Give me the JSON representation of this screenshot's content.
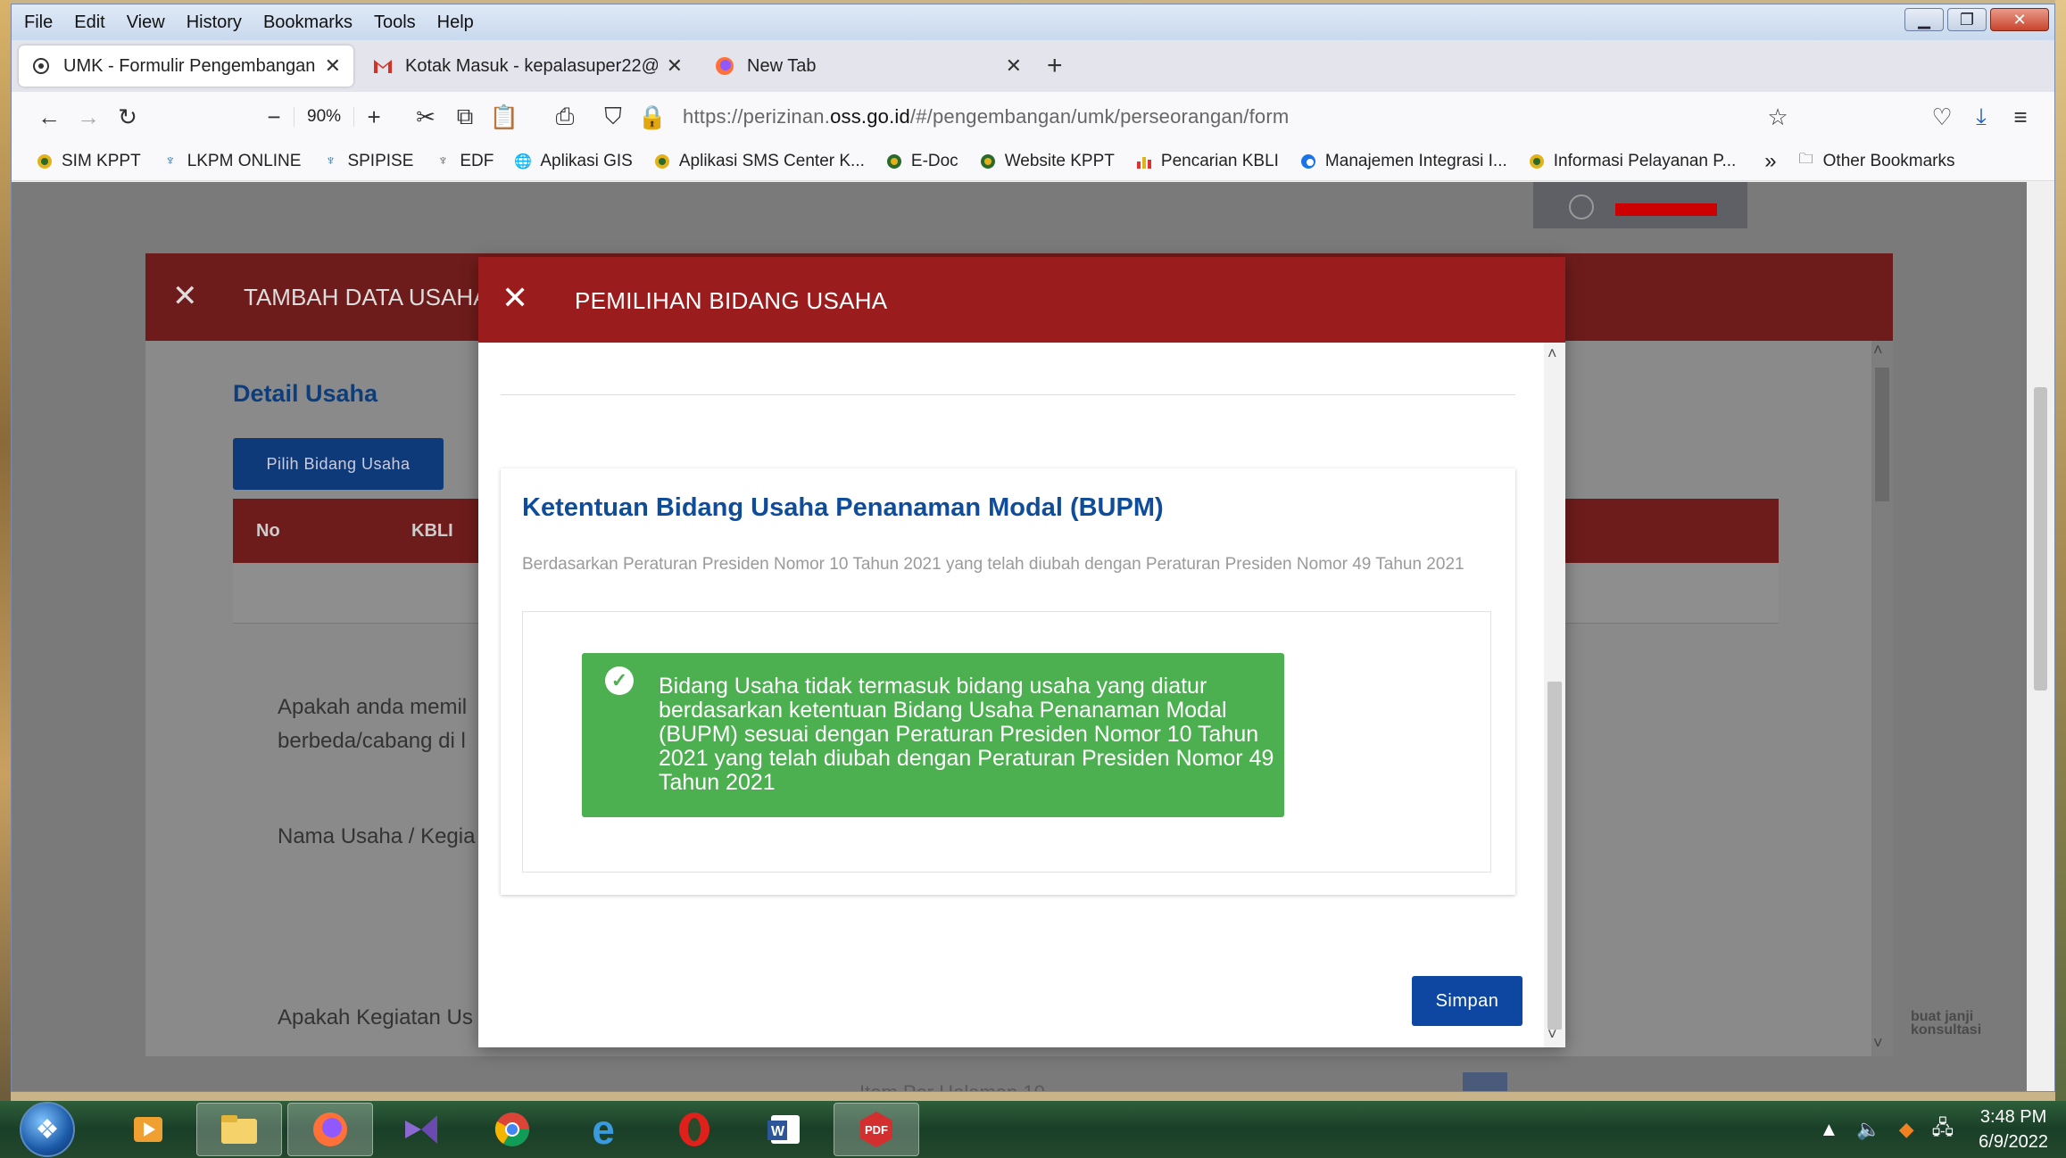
{
  "window": {
    "menu": [
      "File",
      "Edit",
      "View",
      "History",
      "Bookmarks",
      "Tools",
      "Help"
    ]
  },
  "tabs": [
    {
      "label": "UMK - Formulir Pengembangan",
      "icon": "globe-icon",
      "active": true
    },
    {
      "label": "Kotak Masuk - kepalasuper22@",
      "icon": "gmail-icon",
      "active": false
    },
    {
      "label": "New Tab",
      "icon": "firefox-icon",
      "active": false
    }
  ],
  "navbar": {
    "zoom": "90%",
    "url_prefix": "https://perizinan.",
    "url_domain": "oss.go.id",
    "url_path": "/#/pengembangan/umk/perseorangan/form"
  },
  "bookmarks": [
    {
      "label": "SIM KPPT",
      "icon": "emblem-icon"
    },
    {
      "label": "LKPM ONLINE",
      "icon": "garuda-icon"
    },
    {
      "label": "SPIPISE",
      "icon": "garuda-icon"
    },
    {
      "label": "EDF",
      "icon": "garuda-icon"
    },
    {
      "label": "Aplikasi GIS",
      "icon": "globe-icon"
    },
    {
      "label": "Aplikasi SMS Center K...",
      "icon": "emblem-icon"
    },
    {
      "label": "E-Doc",
      "icon": "emblem-icon"
    },
    {
      "label": "Website KPPT",
      "icon": "emblem-icon"
    },
    {
      "label": "Pencarian KBLI",
      "icon": "chart-icon"
    },
    {
      "label": "Manajemen Integrasi I...",
      "icon": "edge-icon"
    },
    {
      "label": "Informasi Pelayanan P...",
      "icon": "emblem-icon"
    }
  ],
  "bookmarks_other": "Other Bookmarks",
  "background_dialog": {
    "title": "TAMBAH DATA USAHA",
    "section_title": "Detail Usaha",
    "select_button": "Pilih Bidang Usaha",
    "table_headers": [
      "No",
      "KBLI"
    ],
    "question_1": "Apakah anda memil\nberbeda/cabang di l",
    "question_2": "Nama Usaha / Kegia",
    "question_3": "Apakah Kegiatan Us"
  },
  "under_page": {
    "pager_text": "Item Per Halaman  10",
    "consult_text": "buat janji\nkonsultasi"
  },
  "modal": {
    "title": "PEMILIHAN BIDANG USAHA",
    "card_title": "Ketentuan Bidang Usaha Penanaman Modal (BUPM)",
    "card_desc": "Berdasarkan Peraturan Presiden Nomor 10 Tahun 2021 yang telah diubah dengan Peraturan Presiden Nomor 49 Tahun 2021",
    "alert_text": "Bidang Usaha tidak termasuk bidang usaha yang diatur berdasarkan ketentuan Bidang Usaha Penanaman Modal (BUPM) sesuai dengan Peraturan Presiden Nomor 10 Tahun 2021 yang telah diubah dengan Peraturan Presiden Nomor 49 Tahun 2021",
    "save_button": "Simpan"
  },
  "taskbar": {
    "apps": [
      "media-player-icon",
      "file-explorer-icon",
      "firefox-icon",
      "visual-studio-icon",
      "chrome-icon",
      "internet-explorer-icon",
      "opera-icon",
      "word-icon",
      "pdf-icon"
    ],
    "time": "3:48 PM",
    "date": "6/9/2022"
  },
  "colors": {
    "modal_header": "#9b1c1c",
    "primary_blue": "#0d47a1",
    "success_green": "#4caf50",
    "title_blue": "#0f4c99"
  }
}
